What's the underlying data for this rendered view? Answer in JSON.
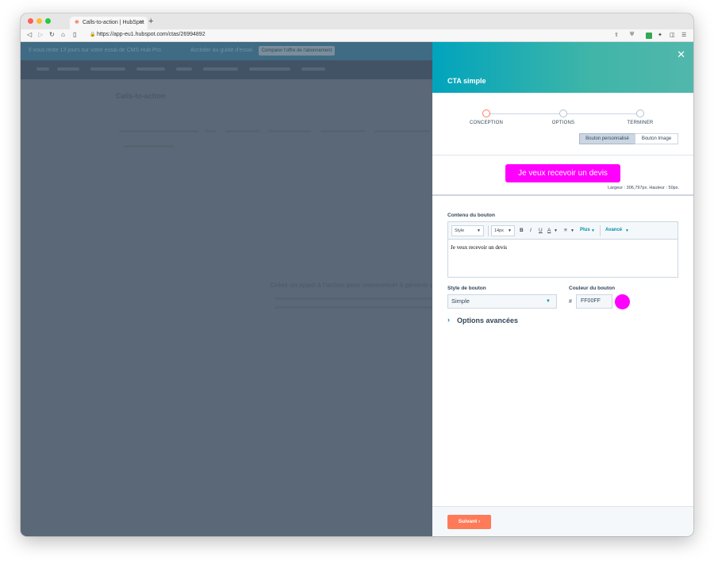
{
  "browser": {
    "tab_title": "Calls-to-action | HubSpot",
    "url": "https://app-eu1.hubspot.com/ctas/26994892",
    "new_tab_label": "+",
    "tab_close_label": "✕"
  },
  "background_page": {
    "trial_text": "Il vous reste 13 jours sur votre essai de CMS Hub Pro.",
    "trial_link": "Accéder au guide d'essai",
    "trial_button": "Comparer l'offre de l'abonnement",
    "heading": "Calls-to-action",
    "empty_title": "Créez un appel à l'action pour commencer à générer des leads"
  },
  "panel": {
    "title": "CTA simple",
    "close_label": "✕",
    "steps": [
      {
        "label": "CONCEPTION",
        "active": true
      },
      {
        "label": "OPTIONS",
        "active": false
      },
      {
        "label": "TERMINER",
        "active": false
      }
    ],
    "button_types": [
      {
        "label": "Bouton personnalisé",
        "selected": true
      },
      {
        "label": "Bouton Image",
        "selected": false
      }
    ],
    "preview": {
      "button_text": "Je veux recevoir un devis",
      "button_color": "#FF00FF",
      "dimensions": "Largeur : 306,797px. Hauteur : 50px."
    },
    "content": {
      "label": "Contenu du bouton",
      "toolbar": {
        "style_select": "Style",
        "size_select": "14px",
        "bold": "B",
        "italic": "I",
        "underline": "U",
        "text_color": "A",
        "align": "≡",
        "more": "Plus",
        "advanced": "Avancé"
      },
      "text": "Je veux recevoir un devis"
    },
    "style": {
      "label": "Style de bouton",
      "value": "Simple"
    },
    "color": {
      "label": "Couleur du bouton",
      "hash": "#",
      "value": "FF00FF"
    },
    "advanced_options": "Options avancées",
    "next_button": "Suivant ›"
  },
  "colors": {
    "accent_orange": "#FF7A59",
    "hubspot_teal": "#00A4BD",
    "cta_magenta": "#FF00FF"
  }
}
